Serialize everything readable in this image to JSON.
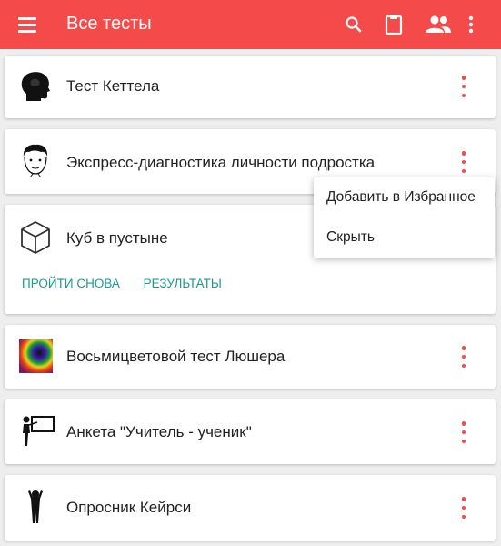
{
  "appbar": {
    "title": "Все тесты",
    "icons": [
      "menu-icon",
      "search-icon",
      "clipboard-icon",
      "people-icon",
      "more-vert-icon"
    ],
    "accent_color": "#f44a4a"
  },
  "tests": [
    {
      "label": "Тест Кеттела",
      "icon": "head-profile-icon"
    },
    {
      "label": "Экспресс-диагностика личности подростка",
      "icon": "boy-face-icon"
    },
    {
      "label": "Куб в пустыне",
      "icon": "cube-icon",
      "actions": [
        "ПРОЙТИ СНОВА",
        "РЕЗУЛЬТАТЫ"
      ]
    },
    {
      "label": "Восьмицветовой тест Люшера",
      "icon": "color-spiral-icon"
    },
    {
      "label": "Анкета \"Учитель - ученик\"",
      "icon": "teacher-board-icon"
    },
    {
      "label": "Опросник Кейрси",
      "icon": "person-figure-icon"
    }
  ],
  "popup_menu": {
    "items": [
      "Добавить в Избранное",
      "Скрыть"
    ]
  },
  "action_color": "#1a9c8c"
}
